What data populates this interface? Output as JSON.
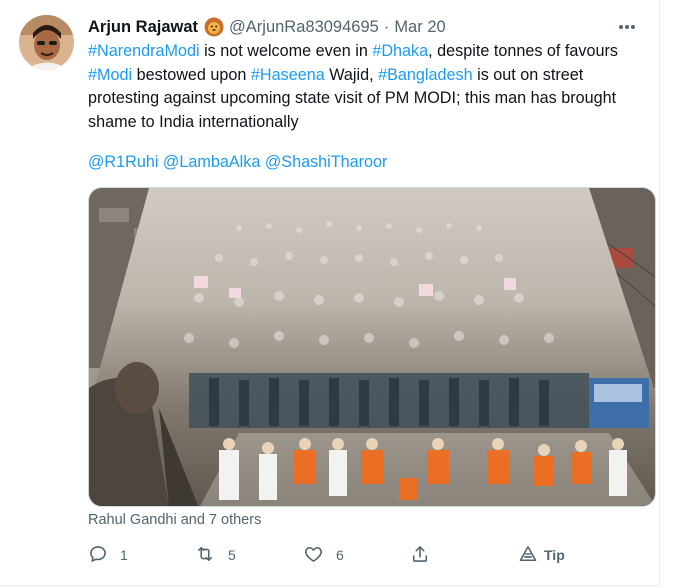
{
  "tweet": {
    "author_name": "Arjun Rajawat",
    "author_badge": "lion-emoji-icon",
    "handle": "@ArjunRa83094695",
    "separator": "·",
    "date": "Mar 20",
    "text_lines": [
      [
        {
          "t": "#NarendraModi",
          "tag": true
        },
        {
          "t": " is not welcome even in ",
          "tag": false
        },
        {
          "t": "#Dhaka",
          "tag": true
        },
        {
          "t": ", despite tonnes of favours",
          "tag": false
        }
      ],
      [
        {
          "t": "#Modi",
          "tag": true
        },
        {
          "t": " bestowed upon ",
          "tag": false
        },
        {
          "t": "#Haseena",
          "tag": true
        },
        {
          "t": " Wajid, ",
          "tag": false
        },
        {
          "t": "#Bangladesh",
          "tag": true
        },
        {
          "t": " is out on street",
          "tag": false
        }
      ],
      [
        {
          "t": "protesting against upcoming state visit of PM MODI; this man has brought",
          "tag": false
        }
      ],
      [
        {
          "t": "shame to India internationally",
          "tag": false
        }
      ]
    ],
    "mentions": [
      "@R1Ruhi",
      "@LambaAlka",
      "@ShashiTharoor"
    ],
    "media_description_icon": "photo-protest-crowd",
    "liked_by": "Rahul Gandhi and 7 others",
    "actions": {
      "reply_count": "1",
      "retweet_count": "5",
      "like_count": "6",
      "tip_label": "Tip"
    }
  },
  "colors": {
    "link": "#1d9bf0",
    "muted": "#536471",
    "text": "#0f1419",
    "border": "#cfd9de"
  }
}
